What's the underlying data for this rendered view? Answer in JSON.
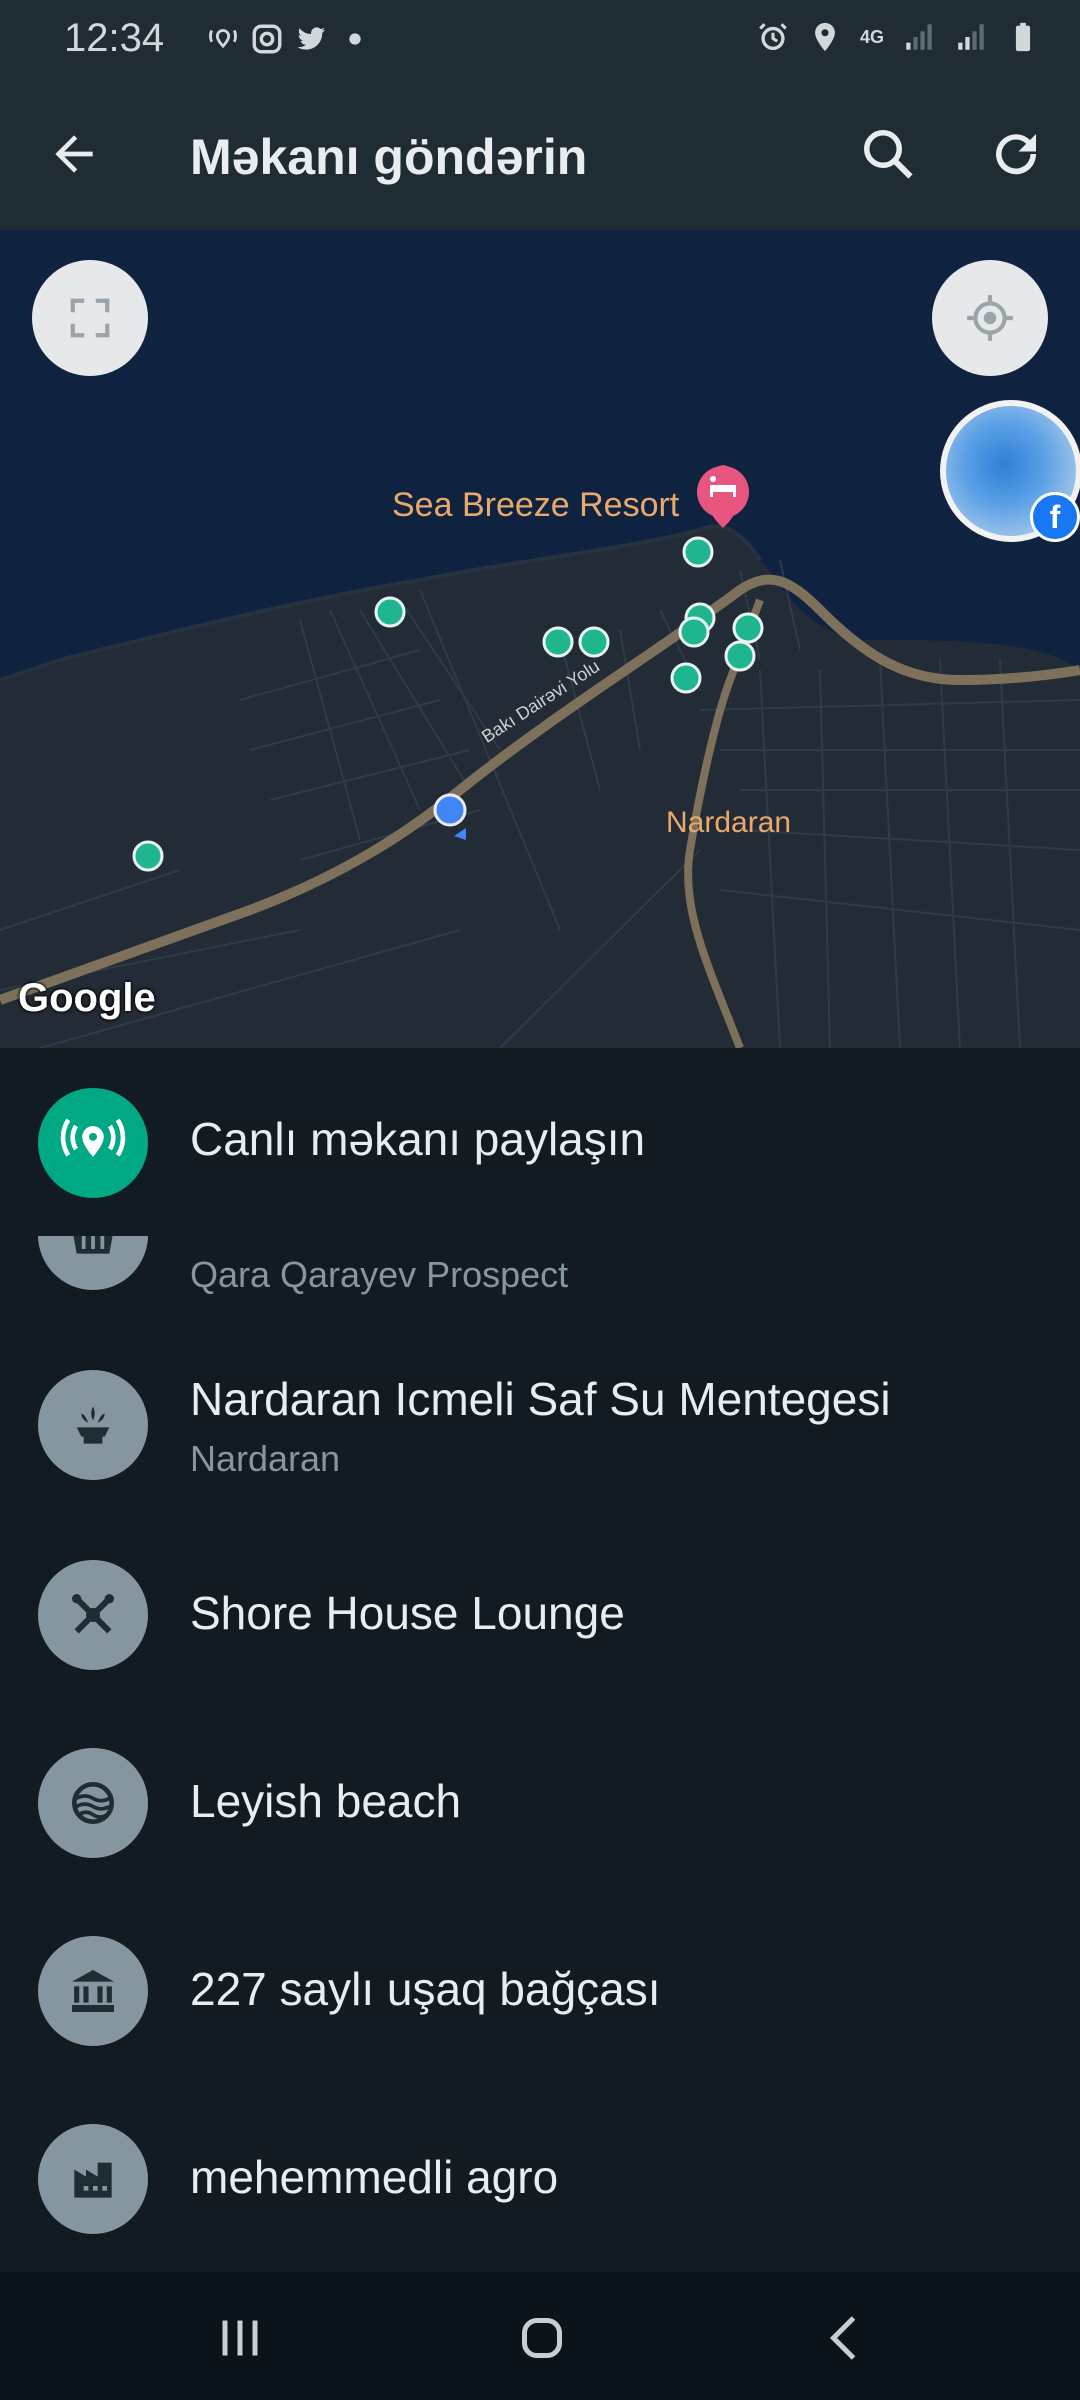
{
  "status_bar": {
    "time": "12:34",
    "network": "4G",
    "left_icons": [
      "wifi-calling-icon",
      "instagram-icon",
      "twitter-icon",
      "dot-icon"
    ],
    "right_icons": [
      "alarm-icon",
      "location-icon",
      "signal-icon",
      "signal-icon",
      "battery-icon"
    ]
  },
  "header": {
    "title": "Məkanı göndərin",
    "back_icon": "arrow-left-icon",
    "search_icon": "search-icon",
    "refresh_icon": "refresh-icon"
  },
  "map": {
    "resort_label": "Sea Breeze Resort",
    "area_label": "Nardaran",
    "road_label": "Bakı Dairəvi Yolu",
    "attribution": "Google",
    "colors": {
      "land": "#222b36",
      "water": "#0f2340",
      "road": "#7d715b",
      "pin": "#1fb58f",
      "resort_pin": "#e8567f",
      "me": "#4285f4"
    }
  },
  "live_location": {
    "label": "Canlı məkanı paylaşın",
    "icon": "live-location-icon",
    "color": "#00a884"
  },
  "places": [
    {
      "name": "",
      "address": "Qara Qarayev Prospect",
      "icon": "basket-icon"
    },
    {
      "name": "Nardaran Icmeli Saf Su Mentegesi",
      "address": "Nardaran",
      "icon": "fountain-icon"
    },
    {
      "name": "Shore House Lounge",
      "address": "",
      "icon": "cutlery-icon"
    },
    {
      "name": "Leyish beach",
      "address": "",
      "icon": "beach-icon"
    },
    {
      "name": "227 saylı uşaq bağçası",
      "address": "",
      "icon": "museum-icon"
    },
    {
      "name": "mehemmedli agro",
      "address": "",
      "icon": "factory-icon"
    }
  ],
  "nav_bar": [
    "recent-apps-icon",
    "home-icon",
    "back-icon"
  ]
}
